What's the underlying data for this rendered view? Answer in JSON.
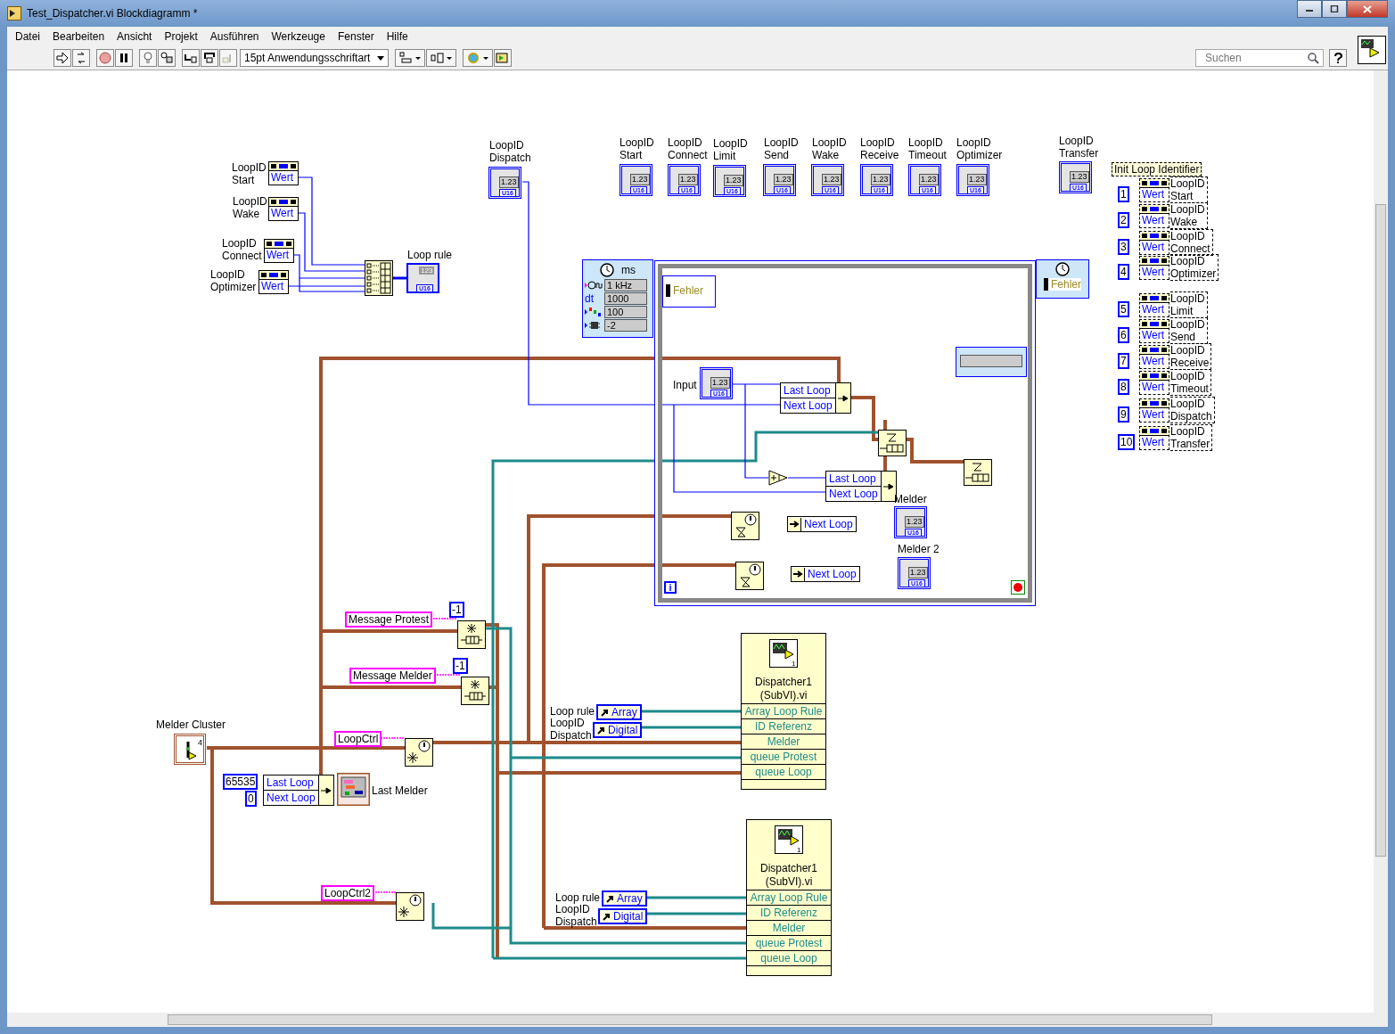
{
  "window": {
    "title": "Test_Dispatcher.vi Blockdiagramm *"
  },
  "menu": [
    "Datei",
    "Bearbeiten",
    "Ansicht",
    "Projekt",
    "Ausführen",
    "Werkzeuge",
    "Fenster",
    "Hilfe"
  ],
  "toolbar": {
    "font": "15pt Anwendungsschriftart",
    "search_placeholder": "Suchen"
  },
  "enum_constants": [
    {
      "label": "LoopID Start",
      "value": "Wert"
    },
    {
      "label": "LoopID Wake",
      "value": "Wert"
    },
    {
      "label": "LoopID Connect",
      "value": "Wert"
    },
    {
      "label": "LoopID Optimizer",
      "value": "Wert"
    }
  ],
  "loop_rule_indicator": {
    "label": "Loop rule",
    "value": "123",
    "type": "U16"
  },
  "numeric_indicators": [
    {
      "label": "LoopID Dispatch",
      "value": "1.23",
      "type": "U16"
    },
    {
      "label": "LoopID Start",
      "value": "1.23",
      "type": "U16"
    },
    {
      "label": "LoopID Connect",
      "value": "1.23",
      "type": "U16"
    },
    {
      "label": "LoopID Limit",
      "value": "1.23",
      "type": "U16"
    },
    {
      "label": "LoopID Send",
      "value": "1.23",
      "type": "U16"
    },
    {
      "label": "LoopID Wake",
      "value": "1.23",
      "type": "U16"
    },
    {
      "label": "LoopID Receive",
      "value": "1.23",
      "type": "U16"
    },
    {
      "label": "LoopID Timeout",
      "value": "1.23",
      "type": "U16"
    },
    {
      "label": "LoopID Optimizer",
      "value": "1.23",
      "type": "U16"
    },
    {
      "label": "LoopID Transfer",
      "value": "1.23",
      "type": "U16"
    }
  ],
  "init_loop_identifier": {
    "title": "Init Loop Identifier",
    "items": [
      {
        "number": "1",
        "value": "Wert",
        "label": "LoopID Start"
      },
      {
        "number": "2",
        "value": "Wert",
        "label": "LoopID Wake"
      },
      {
        "number": "3",
        "value": "Wert",
        "label": "LoopID Connect"
      },
      {
        "number": "4",
        "value": "Wert",
        "label": "LoopID Optimizer"
      },
      {
        "number": "5",
        "value": "Wert",
        "label": "LoopID Limit"
      },
      {
        "number": "6",
        "value": "Wert",
        "label": "LoopID Send"
      },
      {
        "number": "7",
        "value": "Wert",
        "label": "LoopID Receive"
      },
      {
        "number": "8",
        "value": "Wert",
        "label": "LoopID Timeout"
      },
      {
        "number": "9",
        "value": "Wert",
        "label": "LoopID Dispatch"
      },
      {
        "number": "10",
        "value": "Wert",
        "label": "LoopID Transfer"
      }
    ]
  },
  "timed_loop": {
    "unit": "ms",
    "inputs": [
      {
        "kind": "clock",
        "value": "1 kHz"
      },
      {
        "kind": "dt",
        "name": "dt",
        "value": "1000"
      },
      {
        "kind": "priority",
        "value": "100"
      },
      {
        "kind": "processor",
        "value": "-2"
      }
    ],
    "error_in": "Fehler",
    "error_out": "Fehler",
    "input_label": "Input",
    "input_value": "1.23",
    "input_type": "U16",
    "unbundles": [
      {
        "fields": [
          "Last Loop",
          "Next Loop"
        ]
      },
      {
        "fields": [
          "Last Loop",
          "Next Loop"
        ]
      }
    ],
    "notifier_reads": [
      {
        "field": "Next Loop",
        "label": "Melder",
        "value": "1.23",
        "type": "U16"
      },
      {
        "field": "Next Loop",
        "label": "Melder 2",
        "value": "1.23",
        "type": "U16"
      }
    ],
    "iteration": "i"
  },
  "queues": [
    {
      "name": "Message Protest",
      "size": "-1"
    },
    {
      "name": "Message Melder",
      "size": "-1"
    }
  ],
  "notifiers": [
    {
      "name": "LoopCtrl"
    },
    {
      "name": "LoopCtrl2"
    }
  ],
  "melder_cluster": {
    "label": "Melder Cluster",
    "count": "4"
  },
  "bundle": {
    "constants": [
      "65535",
      "0"
    ],
    "fields": [
      "Last Loop",
      "Next Loop"
    ],
    "output_label": "Last Melder"
  },
  "subvis": [
    {
      "title": "Dispatcher1 (SubVI).vi",
      "icon_number": "1",
      "inputs": [
        "Array Loop Rule",
        "ID Referenz",
        "Melder",
        "queue Protest",
        "queue Loop"
      ],
      "loop_rule_label": "Loop rule",
      "loop_rule_value": "Array",
      "loopid_label": "LoopID Dispatch",
      "loopid_value": "Digital"
    },
    {
      "title": "Dispatcher1 (SubVI).vi",
      "icon_number": "1",
      "inputs": [
        "Array Loop Rule",
        "ID Referenz",
        "Melder",
        "queue Protest",
        "queue Loop"
      ],
      "loop_rule_label": "Loop rule",
      "loop_rule_value": "Array",
      "loopid_label": "LoopID Dispatch",
      "loopid_value": "Digital"
    }
  ]
}
